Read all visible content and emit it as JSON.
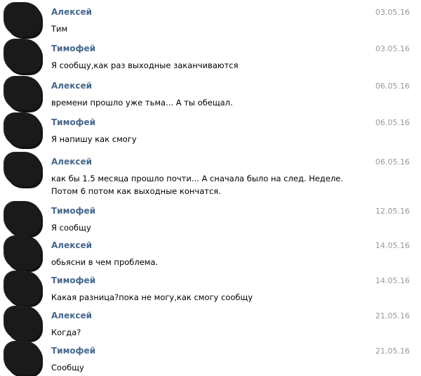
{
  "messages": [
    {
      "sender": "Алексей",
      "date": "03.05.16",
      "text": "Тим"
    },
    {
      "sender": "Тимофей",
      "date": "03.05.16",
      "text": "Я сообщу,как раз выходные заканчиваются"
    },
    {
      "sender": "Алексей",
      "date": "06.05.16",
      "text": "времени прошло уже тьма... А ты обещал."
    },
    {
      "sender": "Тимофей",
      "date": "06.05.16",
      "text": "Я напишу как смогу"
    },
    {
      "sender": "Алексей",
      "date": "06.05.16",
      "text": "как бы 1.5 месяца прошло почти... А сначала было на след. Неделе. Потом 6 потом как выходные кончатся."
    },
    {
      "sender": "Тимофей",
      "date": "12.05.16",
      "text": "Я сообщу"
    },
    {
      "sender": "Алексей",
      "date": "14.05.16",
      "text": "обьясни в чем проблема."
    },
    {
      "sender": "Тимофей",
      "date": "14.05.16",
      "text": "Какая разница?пока не могу,как смогу сообщу"
    },
    {
      "sender": "Алексей",
      "date": "21.05.16",
      "text": "Когда?"
    },
    {
      "sender": "Тимофей",
      "date": "21.05.16",
      "text": "Сообщу"
    }
  ]
}
